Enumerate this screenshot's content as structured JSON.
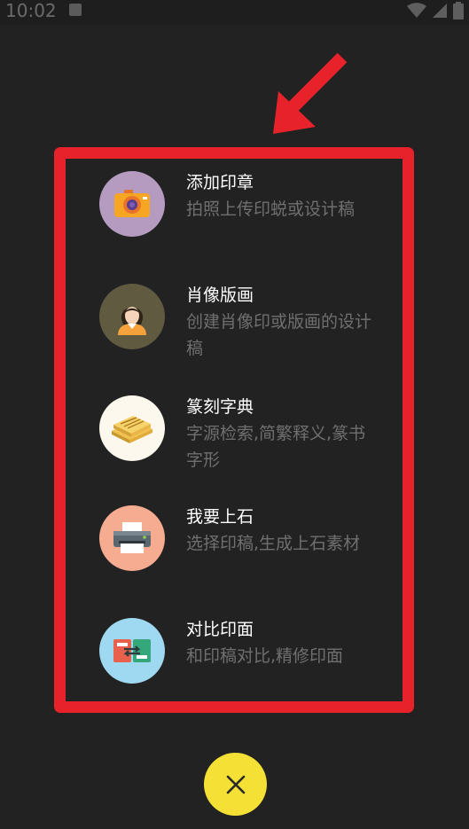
{
  "status_bar": {
    "time": "10:02",
    "icons": [
      "notification-icon",
      "wifi-icon",
      "signal-icon",
      "battery-icon"
    ]
  },
  "annotation": {
    "arrow_icon": "red-arrow-icon",
    "highlight_color": "#e8222b"
  },
  "menu": {
    "items": [
      {
        "title": "添加印章",
        "subtitle": "拍照上传印蜕或设计稿",
        "icon": "camera-icon",
        "bg": "#b59bc0"
      },
      {
        "title": "肖像版画",
        "subtitle": "创建肖像印或版画的设计稿",
        "icon": "portrait-icon",
        "bg": "#5f5a40"
      },
      {
        "title": "篆刻字典",
        "subtitle": "字源检索,简繁释义,篆书字形",
        "icon": "books-icon",
        "bg": "#fcf8ee"
      },
      {
        "title": "我要上石",
        "subtitle": "选择印稿,生成上石素材",
        "icon": "printer-icon",
        "bg": "#f6ac91"
      },
      {
        "title": "对比印面",
        "subtitle": "和印稿对比,精修印面",
        "icon": "compare-icon",
        "bg": "#9fd8f1"
      }
    ]
  },
  "close_button": {
    "icon": "close-icon",
    "color": "#f5e135"
  }
}
